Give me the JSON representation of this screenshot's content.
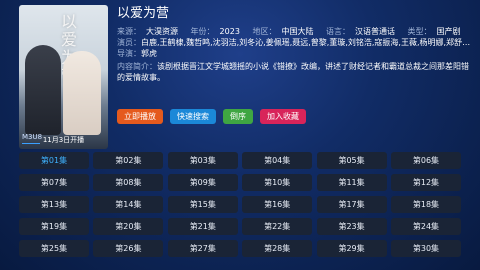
{
  "show": {
    "title": "以爱为营",
    "source_label": "来源：",
    "source": "大淏资源",
    "year_label": "年份：",
    "year": "2023",
    "region_label": "地区：",
    "region": "中国大陆",
    "language_label": "语言：",
    "language": "汉语普通话",
    "type_label": "类型：",
    "type": "国产剧",
    "cast_label": "演员：",
    "cast": "白鹿,王鹤棣,魏哲鸣,沈羽洁,刘冬沁,姜佩瑶,聂远,曾黎,董璇,刘铭浩,寇振海,王薇,杨明娜,郑舒玘,段...",
    "director_label": "导演：",
    "director": "郭虎",
    "intro_label": "内容简介：",
    "intro": "该剧根据晋江文学城翘摇的小说《错撩》改编，讲述了财经记者和霸道总裁之间那差阳错的爱情故事。",
    "poster_title_art": "以爱为营",
    "poster_date": "11月3日开播"
  },
  "buttons": [
    {
      "label": "立即播放",
      "color": "#e55a1d"
    },
    {
      "label": "快速搜索",
      "color": "#1b88d8"
    },
    {
      "label": "倒序",
      "color": "#3fa642"
    },
    {
      "label": "加入收藏",
      "color": "#d8245a"
    }
  ],
  "source_tab": "M3U8",
  "episodes": [
    "第01集",
    "第02集",
    "第03集",
    "第04集",
    "第05集",
    "第06集",
    "第07集",
    "第08集",
    "第09集",
    "第10集",
    "第11集",
    "第12集",
    "第13集",
    "第14集",
    "第15集",
    "第16集",
    "第17集",
    "第18集",
    "第19集",
    "第20集",
    "第21集",
    "第22集",
    "第23集",
    "第24集",
    "第25集",
    "第26集",
    "第27集",
    "第28集",
    "第29集",
    "第30集"
  ],
  "active_episode": 0,
  "accent_color": "#3fb3ff"
}
